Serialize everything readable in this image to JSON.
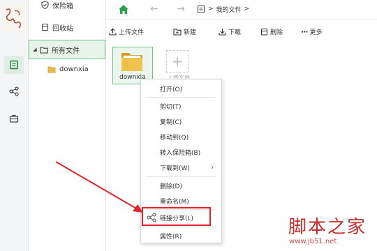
{
  "sidebar": {
    "items": [
      {
        "label": "保险箱",
        "icon": "shield-icon"
      },
      {
        "label": "回收站",
        "icon": "trash-icon"
      },
      {
        "label": "所有文件",
        "icon": "folder-outline-icon"
      },
      {
        "label": "downxia",
        "icon": "folder-icon"
      }
    ]
  },
  "breadcrumb": {
    "current": "我的文件",
    "separator": ">"
  },
  "toolbar": {
    "upload": "上传文件",
    "new": "新建",
    "download": "下载",
    "delete": "删除",
    "more": "更多"
  },
  "files": [
    {
      "name": "downxia",
      "type": "folder"
    }
  ],
  "upload_tile": {
    "label": "上传文件"
  },
  "context_menu": {
    "items": [
      {
        "label": "打开(O)"
      },
      {
        "label": "剪切(T)"
      },
      {
        "label": "复制(C)"
      },
      {
        "label": "移动到(Q)"
      },
      {
        "label": "转入保险箱(B)"
      },
      {
        "label": "下载到(W)",
        "submenu": true
      },
      {
        "label": "删除(D)"
      },
      {
        "label": "重命名(M)"
      },
      {
        "label": "链接分享(L)",
        "highlighted": true
      },
      {
        "label": "属性(R)"
      }
    ]
  },
  "watermark": {
    "brand": "脚本之家",
    "url": "www.jb51.net"
  },
  "colors": {
    "accent_green": "#2ba14a",
    "highlight_red": "#e8242a",
    "arrow_red": "#e0262b"
  }
}
